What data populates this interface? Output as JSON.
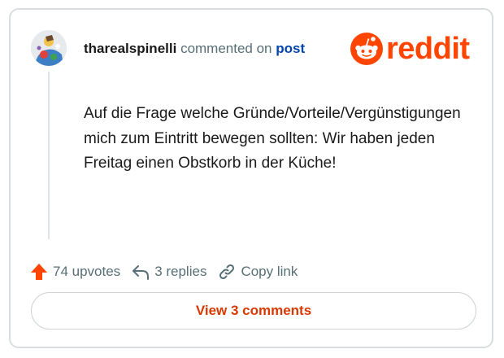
{
  "comment": {
    "username": "tharealspinelli",
    "action_text": "commented on",
    "post_link": "post",
    "body": "Auf die Frage welche Gründe/Vorteile/Vergünstigungen mich zum Eintritt bewegen sollten: Wir haben jeden Freitag einen Obstkorb in der Küche!"
  },
  "brand": {
    "logo_text": "reddit",
    "accent_color": "#ff4500"
  },
  "actions": {
    "upvotes_label": "74 upvotes",
    "replies_label": "3 replies",
    "copy_link_label": "Copy link",
    "upvote_icon": "upvote-arrow-icon",
    "reply_icon": "reply-arrow-icon",
    "link_icon": "link-icon"
  },
  "footer": {
    "view_comments_label": "View 3 comments"
  }
}
